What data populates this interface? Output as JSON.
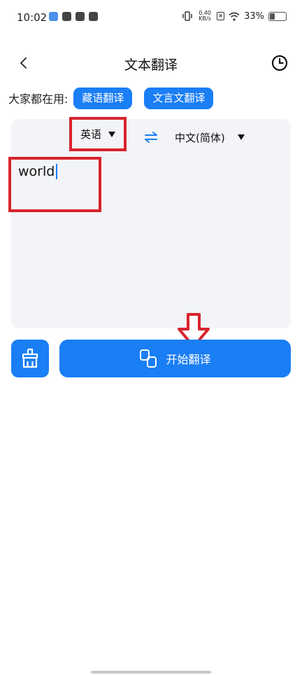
{
  "status_bar": {
    "time": "10:02",
    "net_speed_value": "0.40",
    "net_speed_unit": "KB/s",
    "sim_label": "×",
    "battery": "33%",
    "battery_level": 0.33
  },
  "header": {
    "title": "文本翻译"
  },
  "quick": {
    "label": "大家都在用:",
    "buttons": [
      "藏语翻译",
      "文言文翻译"
    ]
  },
  "languages": {
    "source": "英语",
    "target": "中文(简体)"
  },
  "input": {
    "value": "world"
  },
  "actions": {
    "start_label": "开始翻译"
  },
  "colors": {
    "accent": "#1a7ef5",
    "highlight": "#d9232d",
    "panel_bg": "#f2f4f7"
  }
}
